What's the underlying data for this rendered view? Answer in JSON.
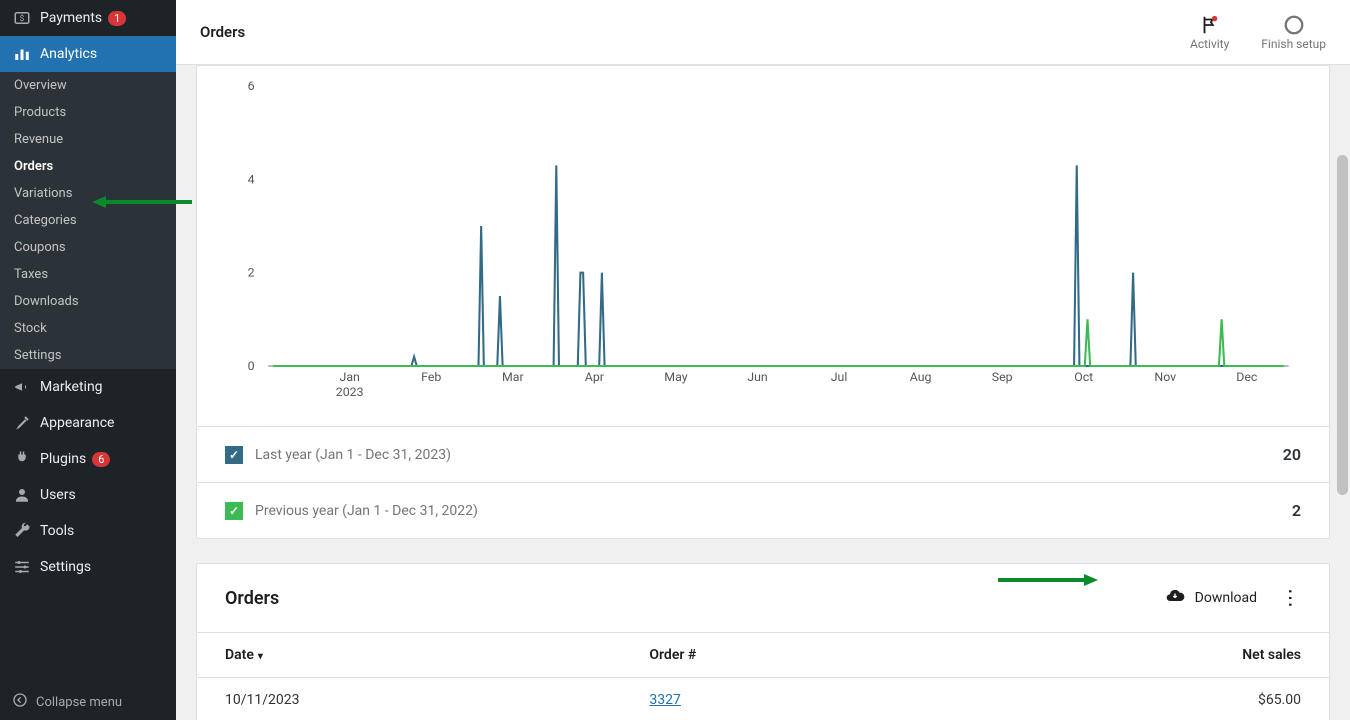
{
  "chart_data": {
    "type": "line",
    "x_months": [
      "Jan",
      "Feb",
      "Mar",
      "Apr",
      "May",
      "Jun",
      "Jul",
      "Aug",
      "Sep",
      "Oct",
      "Nov",
      "Dec"
    ],
    "x_year_label": "2023",
    "y_ticks": [
      0,
      2,
      4,
      6
    ],
    "ylim": [
      0,
      6
    ],
    "title": "",
    "xlabel": "",
    "ylabel": "",
    "series": [
      {
        "name": "Last year (Jan 1 - Dec 31, 2023)",
        "color": "#336b87",
        "total": 20,
        "points": [
          {
            "day": 38,
            "v": 0
          },
          {
            "day": 39,
            "v": 0.2
          },
          {
            "day": 40,
            "v": 0
          },
          {
            "day": 63,
            "v": 0
          },
          {
            "day": 64,
            "v": 3
          },
          {
            "day": 65,
            "v": 0
          },
          {
            "day": 70,
            "v": 0
          },
          {
            "day": 71,
            "v": 1.5
          },
          {
            "day": 72,
            "v": 0
          },
          {
            "day": 91,
            "v": 0
          },
          {
            "day": 92,
            "v": 4.3
          },
          {
            "day": 93,
            "v": 0
          },
          {
            "day": 100,
            "v": 0
          },
          {
            "day": 101,
            "v": 2
          },
          {
            "day": 102,
            "v": 2
          },
          {
            "day": 103,
            "v": 0
          },
          {
            "day": 108,
            "v": 0
          },
          {
            "day": 109,
            "v": 2
          },
          {
            "day": 110,
            "v": 0
          },
          {
            "day": 285,
            "v": 0
          },
          {
            "day": 286,
            "v": 4.3
          },
          {
            "day": 287,
            "v": 0
          },
          {
            "day": 306,
            "v": 0
          },
          {
            "day": 307,
            "v": 2
          },
          {
            "day": 308,
            "v": 0
          }
        ]
      },
      {
        "name": "Previous year (Jan 1 - Dec 31, 2022)",
        "color": "#3cba54",
        "total": 2,
        "points": [
          {
            "day": 289,
            "v": 0
          },
          {
            "day": 290,
            "v": 1
          },
          {
            "day": 291,
            "v": 0
          },
          {
            "day": 339,
            "v": 0
          },
          {
            "day": 340,
            "v": 1
          },
          {
            "day": 341,
            "v": 0
          }
        ]
      }
    ]
  },
  "header": {
    "title": "Orders",
    "activity_label": "Activity",
    "finish_label": "Finish setup"
  },
  "sidebar": {
    "payments": {
      "label": "Payments",
      "badge": "1"
    },
    "analytics": {
      "label": "Analytics"
    },
    "sub": [
      "Overview",
      "Products",
      "Revenue",
      "Orders",
      "Variations",
      "Categories",
      "Coupons",
      "Taxes",
      "Downloads",
      "Stock",
      "Settings"
    ],
    "marketing": "Marketing",
    "appearance": "Appearance",
    "plugins": {
      "label": "Plugins",
      "badge": "6"
    },
    "users": "Users",
    "tools": "Tools",
    "settings": "Settings",
    "collapse": "Collapse menu"
  },
  "legend": {
    "series1_label": "Last year (Jan 1 - Dec 31, 2023)",
    "series1_value": "20",
    "series2_label": "Previous year (Jan 1 - Dec 31, 2022)",
    "series2_value": "2"
  },
  "orders_card": {
    "title": "Orders",
    "download": "Download",
    "col_date": "Date",
    "col_order": "Order #",
    "col_net": "Net sales",
    "rows": [
      {
        "date": "10/11/2023",
        "order": "3327",
        "net": "$65.00"
      }
    ]
  }
}
